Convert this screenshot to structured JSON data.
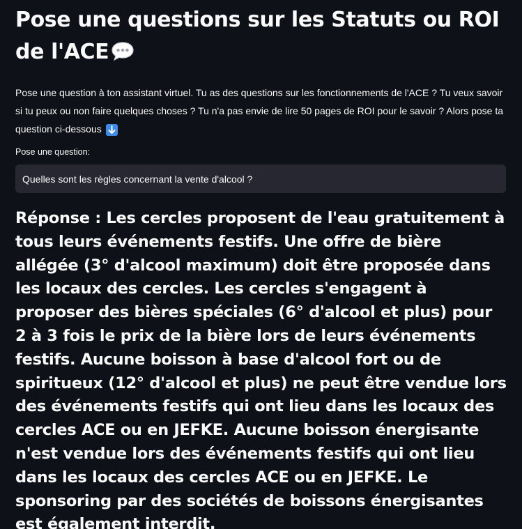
{
  "header": {
    "title": "Pose une questions sur les Statuts ou ROI de l'ACE",
    "title_icon": "speech-bubble-icon"
  },
  "intro": {
    "text": "Pose une question à ton assistant virtuel. Tu as des questions sur les fonctionnements de l'ACE ? Tu veux savoir si tu peux ou non faire quelques choses ? Tu n'a pas envie de lire 50 pages de ROI pour le savoir ? Alors pose ta question ci-dessous",
    "trailing_icon": "down-arrow-icon"
  },
  "question_field": {
    "label": "Pose une question:",
    "value": "Quelles sont les règles concernant la vente d'alcool ?"
  },
  "answer": {
    "text": "Réponse : Les cercles proposent de l'eau gratuitement à tous leurs événements festifs. Une offre de bière allégée (3° d'alcool maximum) doit être proposée dans les locaux des cercles. Les cercles s'engagent à proposer des bières spéciales (6° d'alcool et plus) pour 2 à 3 fois le prix de la bière lors de leurs événements festifs. Aucune boisson à base d'alcool fort ou de spiritueux (12° d'alcool et plus) ne peut être vendue lors des événements festifs qui ont lieu dans les locaux des cercles ACE ou en JEFKE. Aucune boisson énergisante n'est vendue lors des événements festifs qui ont lieu dans les locaux des cercles ACE ou en JEFKE. Le sponsoring par des sociétés de boissons énergisantes est également interdit."
  },
  "colors": {
    "background": "#0e1117",
    "text": "#fafafa",
    "input_background": "#262730",
    "emoji_blue": "#3b8be8"
  }
}
